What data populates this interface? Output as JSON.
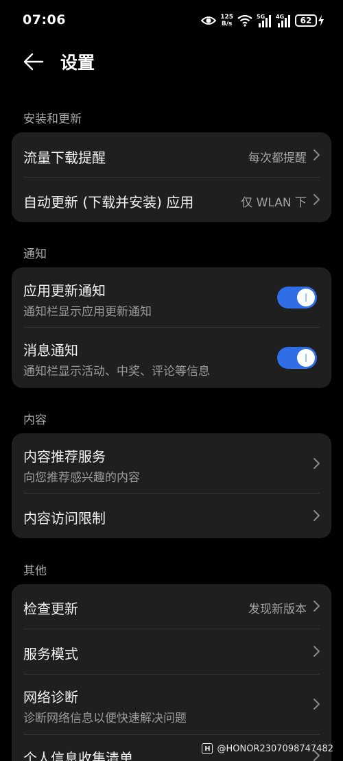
{
  "status_bar": {
    "time": "07:06",
    "net_speed_value": "125",
    "net_speed_unit": "B/s",
    "sim1_label": "5G",
    "sim2_label": "4G",
    "battery": "62"
  },
  "header": {
    "title": "设置"
  },
  "sections": {
    "install_update": {
      "label": "安装和更新",
      "data_download_reminder": {
        "title": "流量下载提醒",
        "value": "每次都提醒"
      },
      "auto_update": {
        "title": "自动更新 (下载并安装) 应用",
        "value": "仅 WLAN 下"
      }
    },
    "notify": {
      "label": "通知",
      "app_update_notify": {
        "title": "应用更新通知",
        "subtitle": "通知栏显示应用更新通知",
        "enabled": true
      },
      "message_notify": {
        "title": "消息通知",
        "subtitle": "通知栏显示活动、中奖、评论等信息",
        "enabled": true
      }
    },
    "content": {
      "label": "内容",
      "recommend_service": {
        "title": "内容推荐服务",
        "subtitle": "向您推荐感兴趣的内容"
      },
      "access_limit": {
        "title": "内容访问限制"
      }
    },
    "other": {
      "label": "其他",
      "check_update": {
        "title": "检查更新",
        "value": "发现新版本"
      },
      "service_mode": {
        "title": "服务模式"
      },
      "network_diagnosis": {
        "title": "网络诊断",
        "subtitle": "诊断网络信息以便快速解决问题"
      },
      "personal_info_list": {
        "title": "个人信息收集清单"
      }
    }
  },
  "watermark": {
    "logo": "H",
    "text": "@HONOR2307098747482"
  },
  "colors": {
    "background": "#000000",
    "card": "#1f1f1f",
    "accent": "#2f6ee6"
  }
}
